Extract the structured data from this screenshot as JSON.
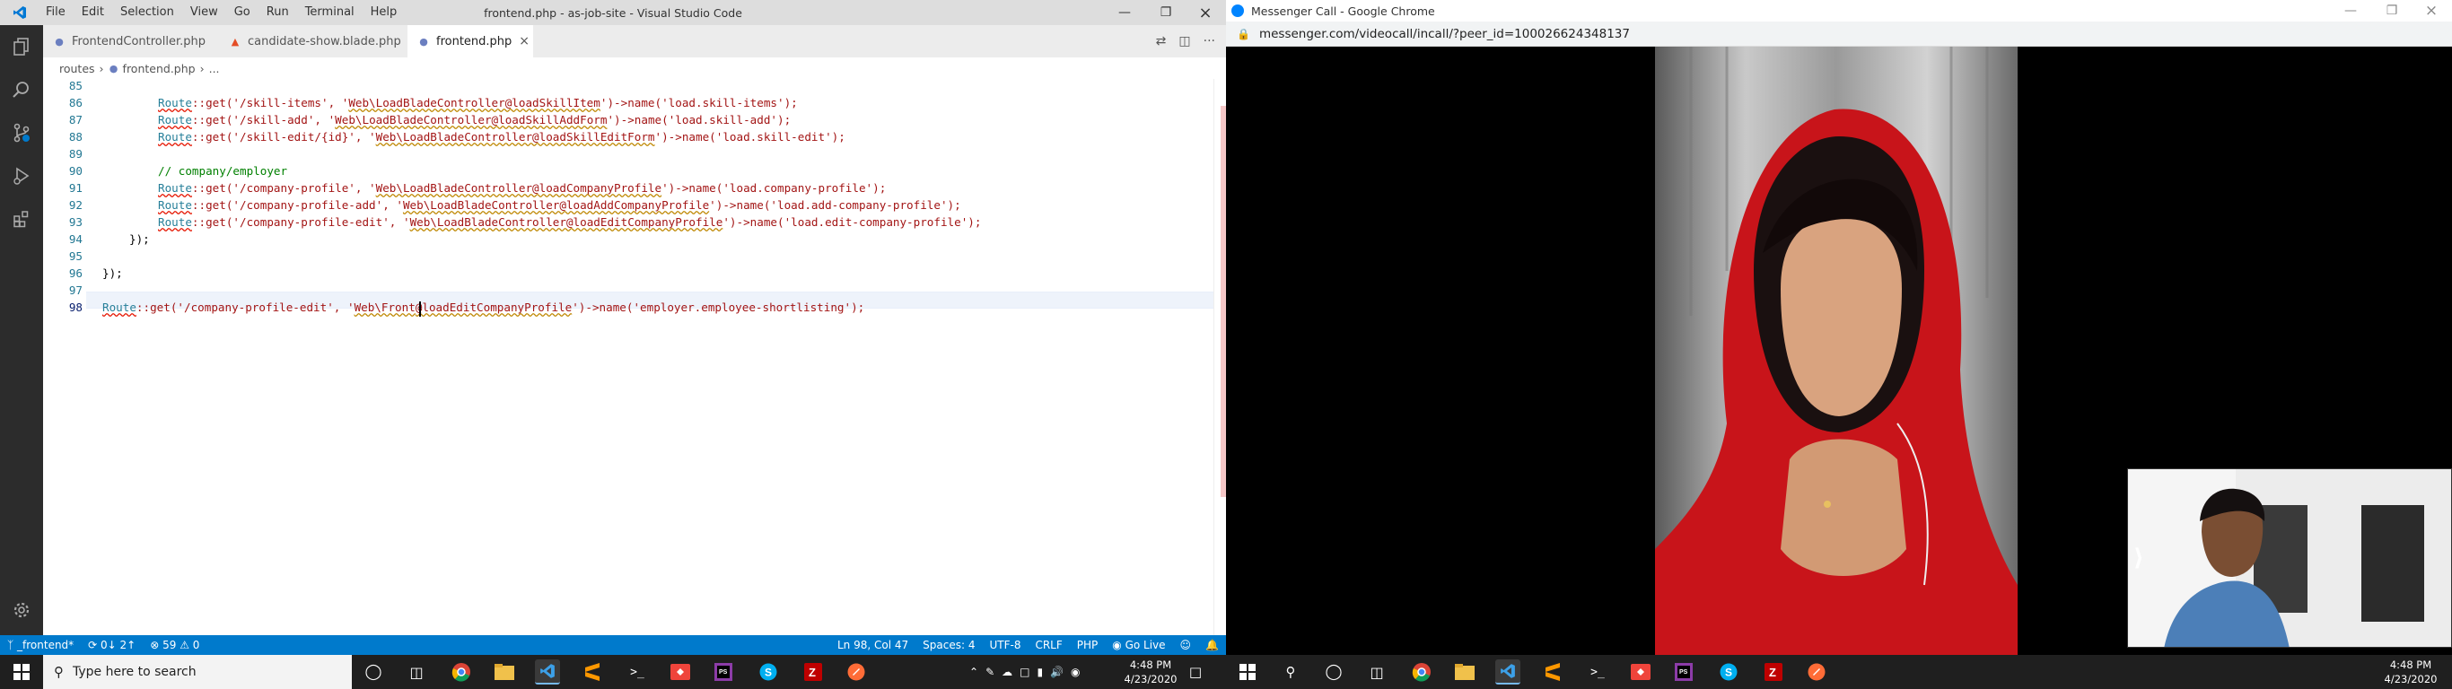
{
  "vscode": {
    "window_title": "frontend.php - as-job-site - Visual Studio Code",
    "menu": [
      "File",
      "Edit",
      "Selection",
      "View",
      "Go",
      "Run",
      "Terminal",
      "Help"
    ],
    "tabs": [
      {
        "label": "FrontendController.php",
        "active": false
      },
      {
        "label": "candidate-show.blade.php",
        "active": false
      },
      {
        "label": "frontend.php",
        "active": true
      }
    ],
    "breadcrumb": {
      "folder": "routes",
      "file": "frontend.php",
      "rest": "..."
    },
    "line_numbers": [
      "85",
      "86",
      "87",
      "88",
      "89",
      "90",
      "91",
      "92",
      "93",
      "94",
      "95",
      "96",
      "97",
      "98"
    ],
    "code": {
      "l86_a": "Route",
      "l86_b": "::get('/skill-items', '",
      "l86_c": "Web\\LoadBladeController@loadSkillItem",
      "l86_d": "')->name('load.skill-items');",
      "l87_a": "Route",
      "l87_b": "::get('/skill-add', '",
      "l87_c": "Web\\LoadBladeController@loadSkillAddForm",
      "l87_d": "')->name('load.skill-add');",
      "l88_a": "Route",
      "l88_b": "::get('/skill-edit/{id}', '",
      "l88_c": "Web\\LoadBladeController@loadSkillEditForm",
      "l88_d": "')->name('load.skill-edit');",
      "l90": "// company/employer",
      "l91_a": "Route",
      "l91_b": "::get('/company-profile', '",
      "l91_c": "Web\\LoadBladeController@loadCompanyProfile",
      "l91_d": "')->name('load.company-profile');",
      "l92_a": "Route",
      "l92_b": "::get('/company-profile-add', '",
      "l92_c": "Web\\LoadBladeController@loadAddCompanyProfile",
      "l92_d": "')->name('load.add-company-profile');",
      "l93_a": "Route",
      "l93_b": "::get('/company-profile-edit', '",
      "l93_c": "Web\\LoadBladeController@loadEditCompanyProfile",
      "l93_d": "')->name('load.edit-company-profile');",
      "l94": "});",
      "l96": "});",
      "l98_a": "Route",
      "l98_b": "::get('/company-profile-edit', '",
      "l98_c": "Web\\Front",
      "l98_d": "@loadEditCompanyProfile",
      "l98_e": "')->name('employer.employee-shortlisting');"
    },
    "status": {
      "branch": "_frontend*",
      "sync": "0↓ 2↑",
      "problems": "⊗ 59 ⚠ 0",
      "position": "Ln 98, Col 47",
      "spaces": "Spaces: 4",
      "encoding": "UTF-8",
      "eol": "CRLF",
      "language": "PHP",
      "golive": "Go Live"
    },
    "colors": {
      "statusbar": "#007acc",
      "activitybar": "#2c2c2c"
    }
  },
  "chrome": {
    "window_title": "Messenger Call - Google Chrome",
    "url": "messenger.com/videocall/incall/?peer_id=100026624348137"
  },
  "taskbar_left": {
    "search_placeholder": "Type here to search",
    "time": "4:48 PM",
    "date": "4/23/2020"
  },
  "taskbar_right": {
    "time": "4:48 PM",
    "date": "4/23/2020"
  }
}
